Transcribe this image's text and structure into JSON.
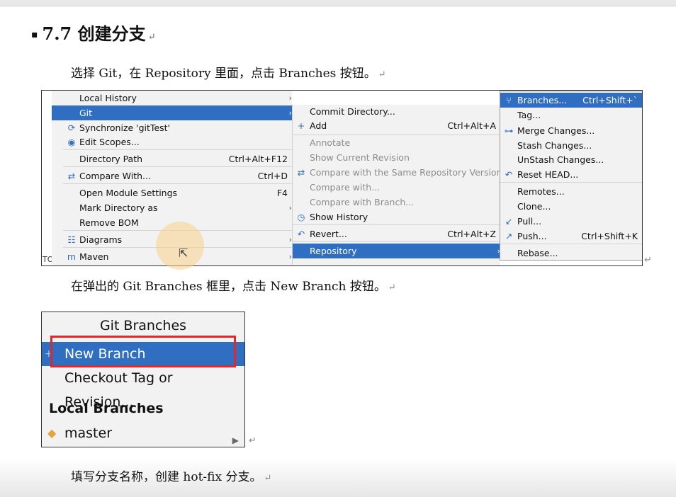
{
  "heading": {
    "bullet": "▪",
    "text": "7.7  创建分支",
    "ret": "↵"
  },
  "para1": {
    "text": "选择 Git，在 Repository 里面，点击 Branches 按钮。",
    "ret": "↵"
  },
  "para2": {
    "text": "在弹出的 Git Branches 框里，点击 New Branch 按钮。",
    "ret": "↵"
  },
  "para3": {
    "text": "填写分支名称，创建 hot-fix 分支。",
    "ret": "↵"
  },
  "ide": {
    "left_label": "TO",
    "menu1": [
      {
        "label": "Local History",
        "arrow": "›"
      },
      {
        "label": "Git",
        "arrow": "›",
        "selected": true
      },
      {
        "label": "Synchronize 'gitTest'",
        "icon": "sync-icon",
        "icon_glyph": "⟳"
      },
      {
        "label": "Edit Scopes...",
        "icon": "scope-icon",
        "icon_glyph": "◉"
      },
      {
        "label": "Directory Path",
        "shortcut": "Ctrl+Alt+F12"
      },
      {
        "label": "Compare With...",
        "shortcut": "Ctrl+D",
        "icon": "compare-icon",
        "icon_glyph": "⇄"
      },
      {
        "label": "Open Module Settings",
        "shortcut": "F4"
      },
      {
        "label": "Mark Directory as",
        "arrow": "›"
      },
      {
        "label": "Remove BOM"
      },
      {
        "label": "Diagrams",
        "arrow": "›",
        "icon": "diagram-icon",
        "icon_glyph": "☷"
      },
      {
        "label": "Maven",
        "arrow": "›",
        "icon": "maven-icon",
        "icon_glyph": "m"
      }
    ],
    "menu2": [
      {
        "label": "Commit Directory..."
      },
      {
        "label": "Add",
        "shortcut": "Ctrl+Alt+A",
        "icon": "plus-icon",
        "icon_glyph": "+"
      },
      {
        "label": "Annotate",
        "disabled": true
      },
      {
        "label": "Show Current Revision",
        "disabled": true
      },
      {
        "label": "Compare with the Same Repository Version",
        "disabled": true,
        "icon": "compare-icon",
        "icon_glyph": "⇄"
      },
      {
        "label": "Compare with...",
        "disabled": true
      },
      {
        "label": "Compare with Branch...",
        "disabled": true
      },
      {
        "label": "Show History",
        "icon": "clock-icon",
        "icon_glyph": "◷"
      },
      {
        "label": "Revert...",
        "shortcut": "Ctrl+Alt+Z",
        "icon": "revert-icon",
        "icon_glyph": "↶"
      },
      {
        "label": "Repository",
        "arrow": "›",
        "selected": true
      }
    ],
    "menu3": [
      {
        "label": "Branches...",
        "shortcut": "Ctrl+Shift+`",
        "selected": true,
        "icon": "branch-icon",
        "icon_glyph": "⑂"
      },
      {
        "label": "Tag..."
      },
      {
        "label": "Merge Changes...",
        "icon": "merge-icon",
        "icon_glyph": "⊶"
      },
      {
        "label": "Stash Changes..."
      },
      {
        "label": "UnStash Changes..."
      },
      {
        "label": "Reset HEAD...",
        "icon": "reset-icon",
        "icon_glyph": "↶"
      },
      {
        "label": "Remotes..."
      },
      {
        "label": "Clone..."
      },
      {
        "label": "Pull...",
        "icon": "pull-icon",
        "icon_glyph": "↙"
      },
      {
        "label": "Push...",
        "shortcut": "Ctrl+Shift+K",
        "icon": "push-icon",
        "icon_glyph": "↗"
      },
      {
        "label": "Rebase..."
      }
    ]
  },
  "git_branches": {
    "title": "Git Branches",
    "new_branch": "New Branch",
    "checkout": "Checkout Tag or Revision...",
    "local_header": "Local Branches",
    "master": "master",
    "ret": "↵"
  },
  "colors": {
    "selection": "#2f6ec1",
    "highlight_box": "#e02828"
  }
}
